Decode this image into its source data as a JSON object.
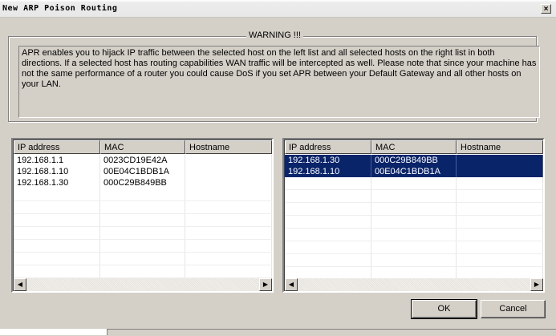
{
  "window": {
    "title": "New ARP Poison Routing",
    "close_glyph": "×"
  },
  "warning": {
    "title": "WARNING !!!",
    "text": "APR enables you to hijack IP traffic between the selected host on the left list and all selected hosts on the right list in both directions. If a selected host has routing capabilities WAN traffic will be intercepted as well. Please note that since your machine has not the same performance of a router you could cause DoS if you set APR between your Default Gateway and all other hosts on your LAN."
  },
  "columns": [
    "IP address",
    "MAC",
    "Hostname"
  ],
  "left_list": {
    "rows": [
      {
        "ip": "192.168.1.1",
        "mac": "0023CD19E42A",
        "host": ""
      },
      {
        "ip": "192.168.1.10",
        "mac": "00E04C1BDB1A",
        "host": ""
      },
      {
        "ip": "192.168.1.30",
        "mac": "000C29B849BB",
        "host": ""
      }
    ]
  },
  "right_list": {
    "rows": [
      {
        "ip": "192.168.1.30",
        "mac": "000C29B849BB",
        "host": "",
        "selected": true
      },
      {
        "ip": "192.168.1.10",
        "mac": "00E04C1BDB1A",
        "host": "",
        "selected": true
      }
    ]
  },
  "buttons": {
    "ok": "OK",
    "cancel": "Cancel"
  },
  "icons": {
    "scroll_left": "◀",
    "scroll_right": "▶"
  },
  "colors": {
    "dialog_bg": "#d4d0c8",
    "selection": "#0a246a"
  }
}
